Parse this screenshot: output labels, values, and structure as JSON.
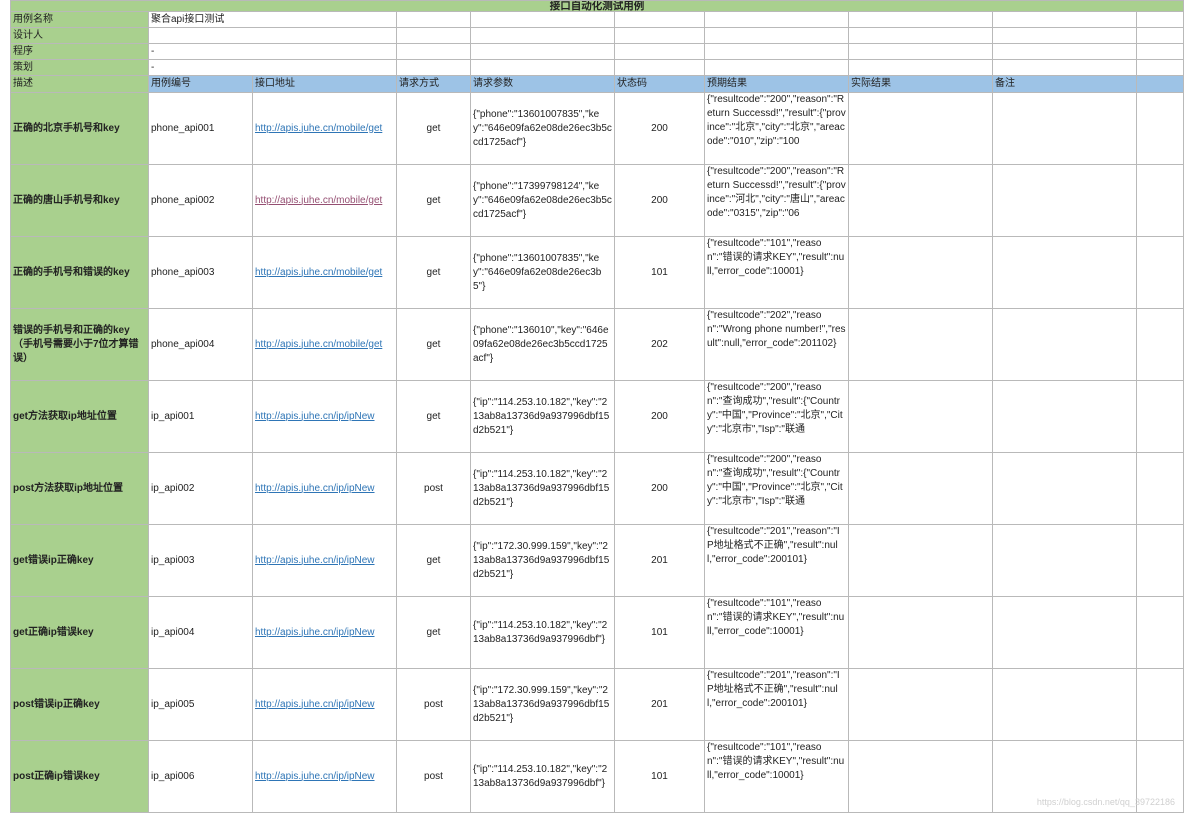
{
  "sheet": {
    "title": "接口自动化测试用例",
    "meta": [
      {
        "label": "用例名称",
        "value": "聚合api接口测试"
      },
      {
        "label": "设计人",
        "value": ""
      },
      {
        "label": "程序",
        "value": "-"
      },
      {
        "label": "策划",
        "value": "-"
      }
    ],
    "headers": [
      "描述",
      "用例编号",
      "接口地址",
      "请求方式",
      "请求参数",
      "状态码",
      "预期结果",
      "实际结果",
      "备注",
      ""
    ],
    "rows": [
      {
        "desc": "正确的北京手机号和key",
        "id": "phone_api001",
        "url": "http://apis.juhe.cn/mobile/get",
        "method": "get",
        "params": "{\"phone\":\"13601007835\",\"key\":\"646e09fa62e08de26ec3b5ccd1725acf\"}",
        "status": "200",
        "expected": "{\"resultcode\":\"200\",\"reason\":\"Return Successd!\",\"result\":{\"province\":\"北京\",\"city\":\"北京\",\"areacode\":\"010\",\"zip\":\"100"
      },
      {
        "desc": "正确的唐山手机号和key",
        "id": "phone_api002",
        "url": "http://apis.juhe.cn/mobile/get",
        "method": "get",
        "params": "{\"phone\":\"17399798124\",\"key\":\"646e09fa62e08de26ec3b5ccd1725acf\"}",
        "status": "200",
        "expected": "{\"resultcode\":\"200\",\"reason\":\"Return Successd!\",\"result\":{\"province\":\"河北\",\"city\":\"唐山\",\"areacode\":\"0315\",\"zip\":\"06"
      },
      {
        "desc": "正确的手机号和错误的key",
        "id": "phone_api003",
        "url": "http://apis.juhe.cn/mobile/get",
        "method": "get",
        "params": "{\"phone\":\"13601007835\",\"key\":\"646e09fa62e08de26ec3b5\"}",
        "status": "101",
        "expected": "{\"resultcode\":\"101\",\"reason\":\"错误的请求KEY\",\"result\":null,\"error_code\":10001}"
      },
      {
        "desc": "错误的手机号和正确的key（手机号需要小于7位才算错误）",
        "id": "phone_api004",
        "url": "http://apis.juhe.cn/mobile/get",
        "method": "get",
        "params": "{\"phone\":\"136010\",\"key\":\"646e09fa62e08de26ec3b5ccd1725acf\"}",
        "status": "202",
        "expected": "{\"resultcode\":\"202\",\"reason\":\"Wrong phone number!\",\"result\":null,\"error_code\":201102}"
      },
      {
        "desc": "get方法获取ip地址位置",
        "id": "ip_api001",
        "url": "http://apis.juhe.cn/ip/ipNew",
        "method": "get",
        "params": "{\"ip\":\"114.253.10.182\",\"key\":\"213ab8a13736d9a937996dbf15d2b521\"}",
        "status": "200",
        "expected": "{\"resultcode\":\"200\",\"reason\":\"查询成功\",\"result\":{\"Country\":\"中国\",\"Province\":\"北京\",\"City\":\"北京市\",\"Isp\":\"联通"
      },
      {
        "desc": "post方法获取ip地址位置",
        "id": "ip_api002",
        "url": "http://apis.juhe.cn/ip/ipNew",
        "method": "post",
        "params": "{\"ip\":\"114.253.10.182\",\"key\":\"213ab8a13736d9a937996dbf15d2b521\"}",
        "status": "200",
        "expected": "{\"resultcode\":\"200\",\"reason\":\"查询成功\",\"result\":{\"Country\":\"中国\",\"Province\":\"北京\",\"City\":\"北京市\",\"Isp\":\"联通"
      },
      {
        "desc": "get错误ip正确key",
        "id": "ip_api003",
        "url": "http://apis.juhe.cn/ip/ipNew",
        "method": "get",
        "params": "{\"ip\":\"172.30.999.159\",\"key\":\"213ab8a13736d9a937996dbf15d2b521\"}",
        "status": "201",
        "expected": "{\"resultcode\":\"201\",\"reason\":\"IP地址格式不正确\",\"result\":null,\"error_code\":200101}"
      },
      {
        "desc": "get正确ip错误key",
        "id": "ip_api004",
        "url": "http://apis.juhe.cn/ip/ipNew",
        "method": "get",
        "params": "{\"ip\":\"114.253.10.182\",\"key\":\"213ab8a13736d9a937996dbf\"}",
        "status": "101",
        "expected": "{\"resultcode\":\"101\",\"reason\":\"错误的请求KEY\",\"result\":null,\"error_code\":10001}"
      },
      {
        "desc": "post错误ip正确key",
        "id": "ip_api005",
        "url": "http://apis.juhe.cn/ip/ipNew",
        "method": "post",
        "params": "{\"ip\":\"172.30.999.159\",\"key\":\"213ab8a13736d9a937996dbf15d2b521\"}",
        "status": "201",
        "expected": "{\"resultcode\":\"201\",\"reason\":\"IP地址格式不正确\",\"result\":null,\"error_code\":200101}"
      },
      {
        "desc": "post正确ip错误key",
        "id": "ip_api006",
        "url": "http://apis.juhe.cn/ip/ipNew",
        "method": "post",
        "params": "{\"ip\":\"114.253.10.182\",\"key\":\"213ab8a13736d9a937996dbf\"}",
        "status": "101",
        "expected": "{\"resultcode\":\"101\",\"reason\":\"错误的请求KEY\",\"result\":null,\"error_code\":10001}"
      }
    ]
  },
  "watermark": "https://blog.csdn.net/qq_39722186"
}
